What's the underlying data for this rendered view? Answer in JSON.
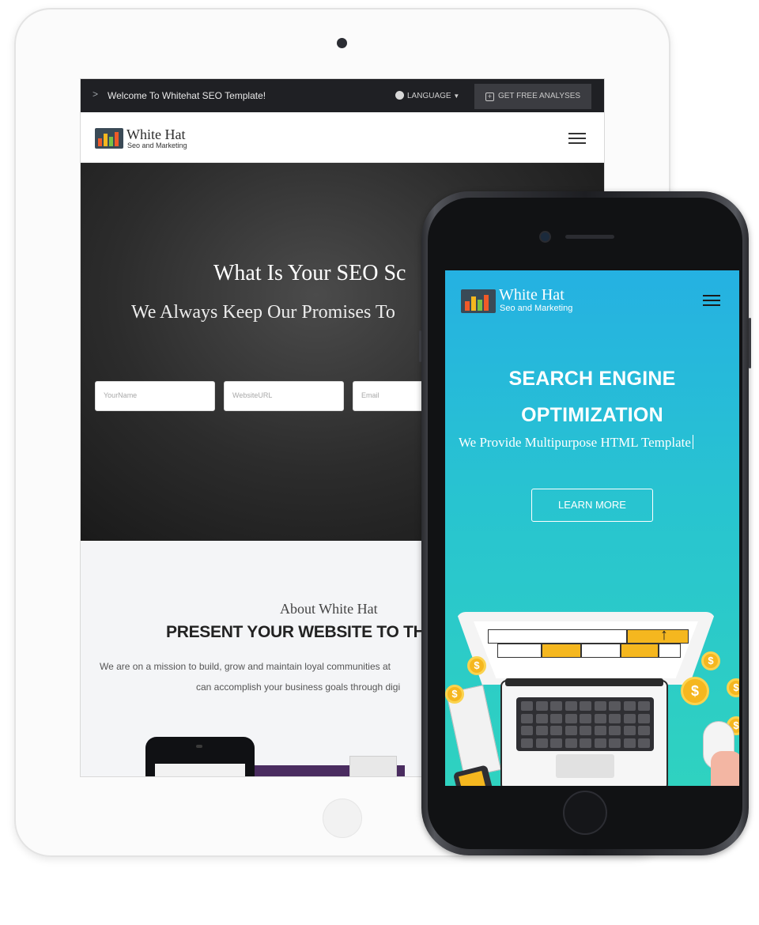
{
  "tablet": {
    "topbar": {
      "chevron": ">",
      "welcome": "Welcome To Whitehat SEO Template!",
      "language": "LANGUAGE",
      "free_analyses": "GET FREE ANALYSES"
    },
    "nav": {
      "brand": "White Hat",
      "tagline": "Seo and Marketing"
    },
    "hero": {
      "heading": "What Is Your SEO Sc",
      "subheading": "We Always Keep Our Promises To",
      "inputs": {
        "name_placeholder": "YourName",
        "url_placeholder": "WebsiteURL",
        "email_placeholder": "Email"
      }
    },
    "about": {
      "subtitle": "About White Hat",
      "title": "PRESENT YOUR WEBSITE TO TH",
      "text_line1": "We are on a mission to build, grow and maintain loyal communities at",
      "text_line2": "can accomplish your business goals through digi"
    }
  },
  "phone": {
    "nav": {
      "brand": "White Hat",
      "tagline": "Seo and Marketing"
    },
    "hero": {
      "title_line1": "SEARCH ENGINE",
      "title_line2": "OPTIMIZATION",
      "subtitle": "We Provide Multipurpose HTML Template",
      "button": "LEARN MORE"
    },
    "illustration": {
      "coin_symbol": "$",
      "arrow": "↑"
    }
  },
  "colors": {
    "tablet_topbar": "#1f2024",
    "tablet_hero": "#2c2c2c",
    "phone_gradient_top": "#25b1e2",
    "phone_gradient_bottom": "#2fd2c0",
    "accent_yellow": "#f5b71f"
  }
}
